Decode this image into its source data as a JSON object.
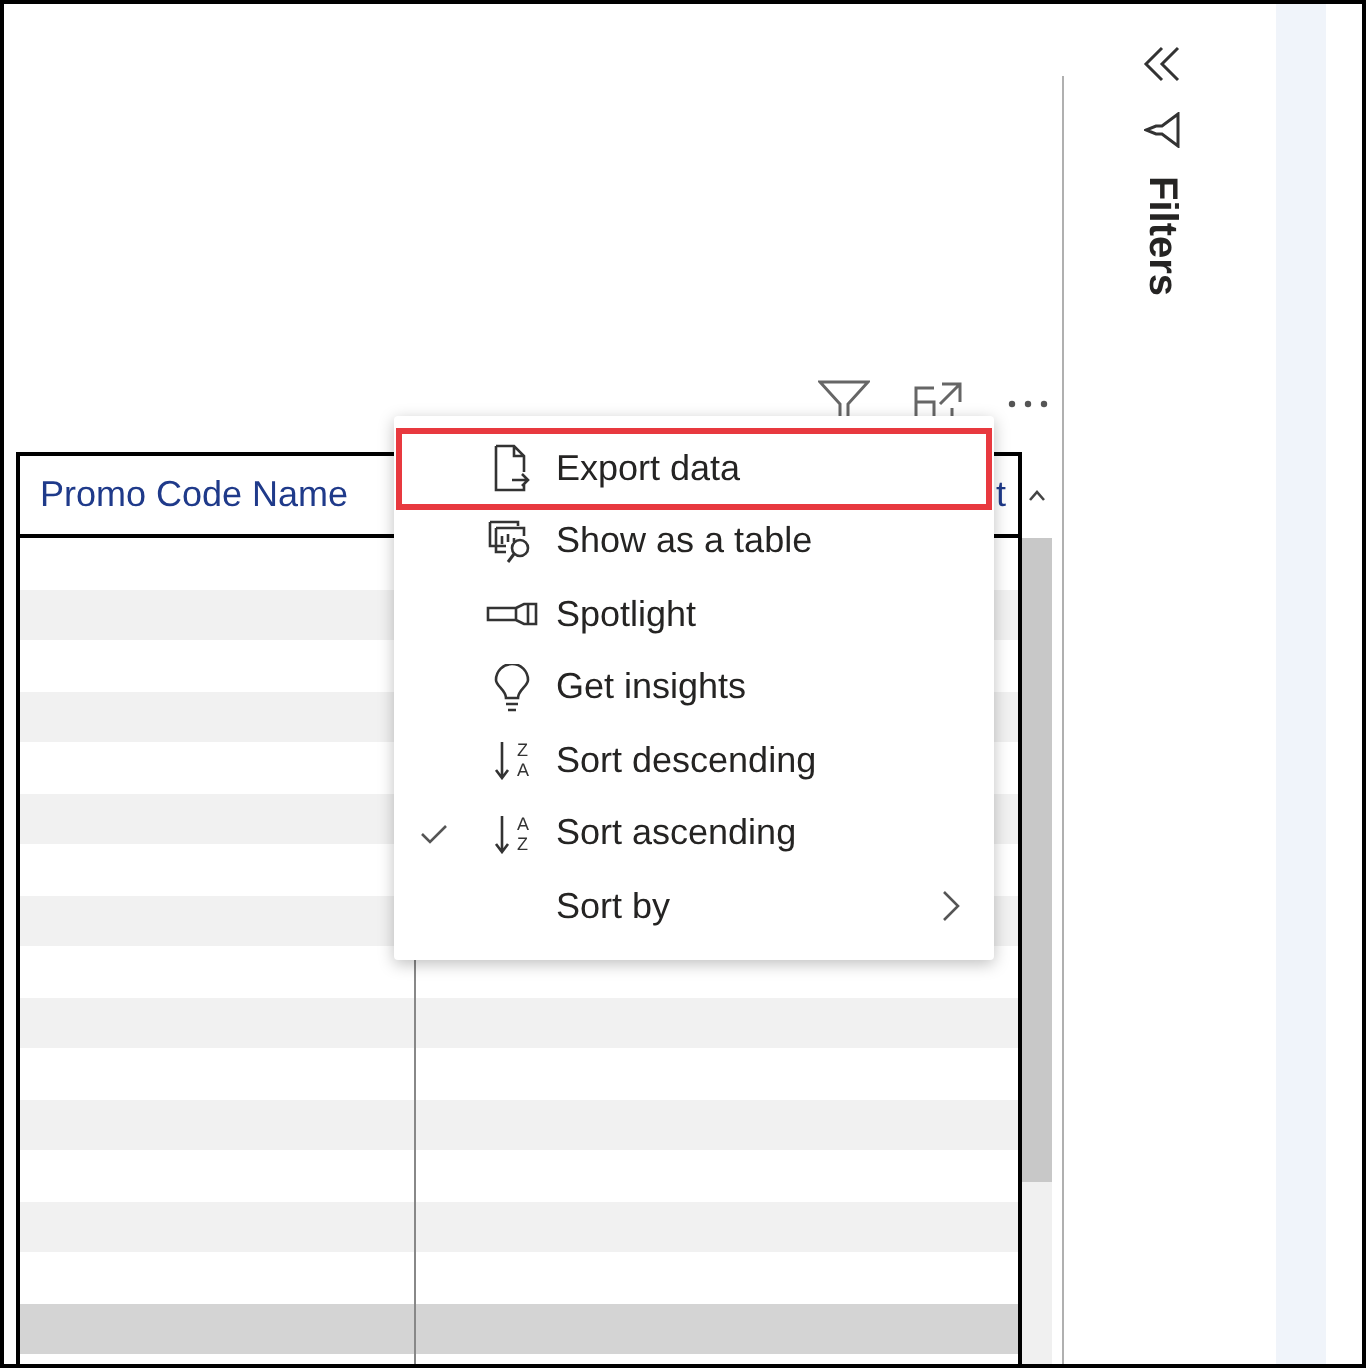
{
  "table": {
    "columns": [
      "Promo Code Name",
      "t"
    ]
  },
  "context_menu": {
    "items": [
      {
        "label": "Export data",
        "kind": "action",
        "checked": false,
        "highlighted": true
      },
      {
        "label": "Show as a table",
        "kind": "action",
        "checked": false,
        "highlighted": false
      },
      {
        "label": "Spotlight",
        "kind": "action",
        "checked": false,
        "highlighted": false
      },
      {
        "label": "Get insights",
        "kind": "action",
        "checked": false,
        "highlighted": false
      },
      {
        "label": "Sort descending",
        "kind": "sort",
        "glyphs": [
          "Z",
          "A"
        ],
        "checked": false,
        "highlighted": false
      },
      {
        "label": "Sort ascending",
        "kind": "sort",
        "glyphs": [
          "A",
          "Z"
        ],
        "checked": true,
        "highlighted": false
      },
      {
        "label": "Sort by",
        "kind": "submenu",
        "checked": false,
        "highlighted": false
      }
    ]
  },
  "filters_pane": {
    "title": "Filters"
  }
}
